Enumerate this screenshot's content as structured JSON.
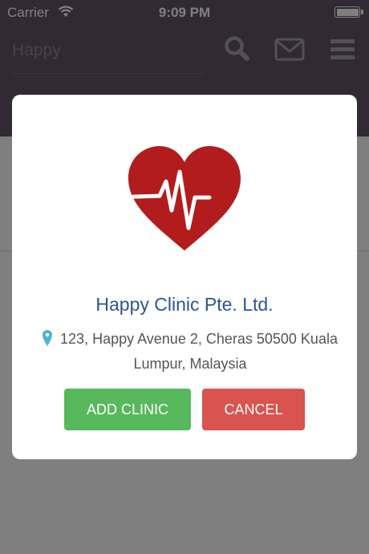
{
  "status_bar": {
    "carrier": "Carrier",
    "time": "9:09 PM"
  },
  "header": {
    "search_placeholder": "Happy",
    "icons": [
      "search-icon",
      "mail-icon",
      "menu-icon"
    ]
  },
  "modal": {
    "logo": "heart-pulse-logo",
    "clinic_name": "Happy Clinic Pte. Ltd.",
    "address": "123, Happy Avenue 2, Cheras 50500 Kuala Lumpur, Malaysia",
    "add_label": "ADD CLINIC",
    "cancel_label": "CANCEL"
  },
  "colors": {
    "header_bg": "#625468",
    "heart_red": "#b31c1c",
    "clinic_name_blue": "#2b5596",
    "add_button_green": "#58b85c",
    "cancel_button_red": "#d9534f",
    "pin_cyan": "#4ab3d1"
  }
}
